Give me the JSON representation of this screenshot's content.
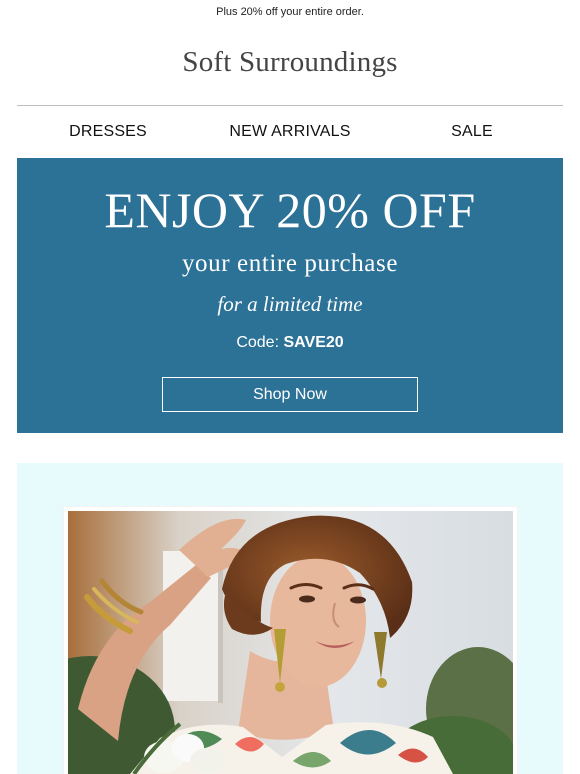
{
  "preheader": {
    "text": "Plus 20% off your entire order."
  },
  "header": {
    "logo_text": "Soft Surroundings"
  },
  "nav": {
    "items": [
      {
        "label": "DRESSES"
      },
      {
        "label": "NEW ARRIVALS"
      },
      {
        "label": "SALE"
      }
    ]
  },
  "promo": {
    "headline": "ENJOY 20% OFF",
    "subheadline": "your entire purchase",
    "timeframe": "for a limited time",
    "code_label": "Code:",
    "code_value": "SAVE20",
    "button_label": "Shop Now",
    "background_color": "#2c7196"
  },
  "hero": {
    "background_color": "#e7fbfd"
  }
}
